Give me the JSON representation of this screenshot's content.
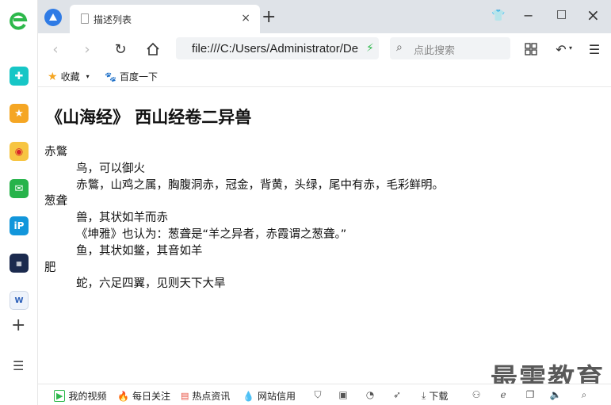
{
  "tab": {
    "title": "描述列表",
    "close": "×",
    "new_tab": "+"
  },
  "window": {
    "minimize": "−",
    "maximize": "□",
    "close": "×"
  },
  "address": {
    "url": "file:///C:/Users/Administrator/De"
  },
  "search": {
    "placeholder": "点此搜索"
  },
  "bookmarks": {
    "favorites": "收藏",
    "baidu": "百度一下"
  },
  "page": {
    "title": "《山海经》 西山经卷二异兽",
    "list": [
      {
        "term": "赤鷩",
        "defs": [
          "鸟，可以御火",
          "赤鷩，山鸡之属，胸腹洞赤，冠金，背黄，头绿，尾中有赤，毛彩鲜明。"
        ]
      },
      {
        "term": "葱聋",
        "defs": [
          "兽，其状如羊而赤",
          "《坤雅》也认为：葱聋是“羊之异者，赤霞谓之葱聋。”",
          "鱼，其状如鳖，其音如羊"
        ]
      },
      {
        "term": "肥𧔥",
        "defs": [
          "蛇，六足四翼，见则天下大旱"
        ]
      }
    ]
  },
  "watermark": "最需教育",
  "statusbar": {
    "video": "我的视频",
    "daily": "每日关注",
    "hot": "热点资讯",
    "trust": "网站信用",
    "download": "下载"
  },
  "colors": {
    "tabbar_bg": "#dfe3e8",
    "star": "#f5a623",
    "green": "#2fb54a",
    "red": "#e74c3c"
  }
}
